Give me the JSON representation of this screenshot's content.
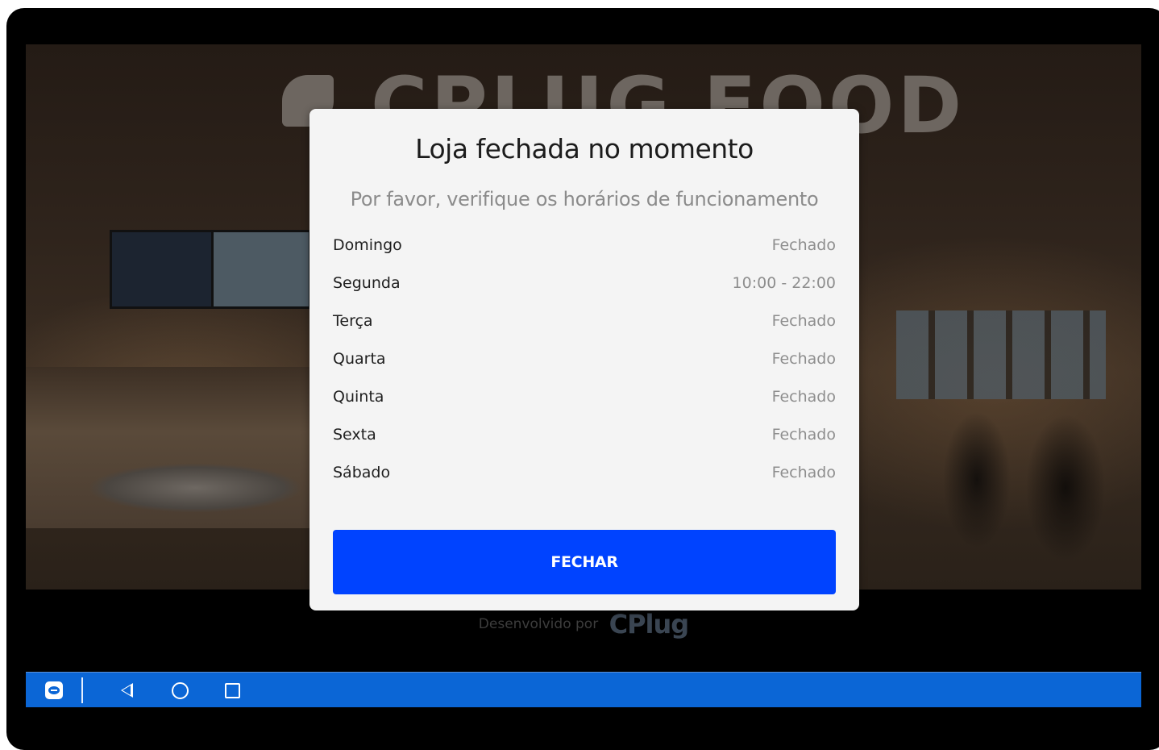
{
  "background": {
    "sign_text": "CPLUG FOOD"
  },
  "modal": {
    "title": "Loja fechada no momento",
    "subtitle": "Por favor, verifique os horários de funcionamento",
    "hours": [
      {
        "day": "Domingo",
        "time": "Fechado"
      },
      {
        "day": "Segunda",
        "time": "10:00 - 22:00"
      },
      {
        "day": "Terça",
        "time": "Fechado"
      },
      {
        "day": "Quarta",
        "time": "Fechado"
      },
      {
        "day": "Quinta",
        "time": "Fechado"
      },
      {
        "day": "Sexta",
        "time": "Fechado"
      },
      {
        "day": "Sábado",
        "time": "Fechado"
      }
    ],
    "close_label": "FECHAR"
  },
  "footer": {
    "developed_by": "Desenvolvido por",
    "brand": "CPlug"
  },
  "navbar": {
    "icons": [
      "teamviewer-icon",
      "back-icon",
      "home-icon",
      "recents-icon"
    ]
  },
  "colors": {
    "primary_button": "#0043ff",
    "navbar": "#0b66d6",
    "modal_bg": "#f4f4f4"
  }
}
